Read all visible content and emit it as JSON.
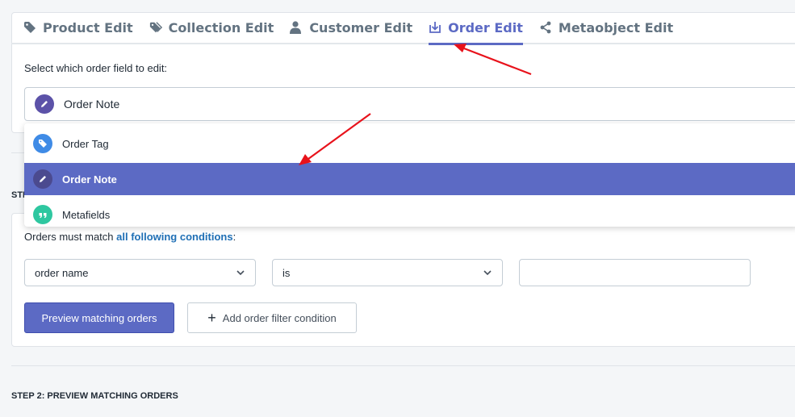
{
  "tabs": [
    {
      "label": "Product Edit",
      "icon": "tag-icon"
    },
    {
      "label": "Collection Edit",
      "icon": "tags-icon"
    },
    {
      "label": "Customer Edit",
      "icon": "user-icon"
    },
    {
      "label": "Order Edit",
      "icon": "download-icon",
      "active": true
    },
    {
      "label": "Metaobject Edit",
      "icon": "share-icon"
    }
  ],
  "field_select": {
    "label": "Select which order field to edit:",
    "value": "Order Note",
    "options": [
      {
        "label": "Order Tag",
        "icon": "tag-icon"
      },
      {
        "label": "Order Note",
        "icon": "pencil-icon",
        "selected": true
      },
      {
        "label": "Metafields",
        "icon": "quote-icon"
      }
    ]
  },
  "step1_partial": "STI",
  "conditions": {
    "prefix": "Orders must match ",
    "link": "all following conditions",
    "suffix": ":",
    "field": "order name",
    "operator": "is",
    "value": ""
  },
  "buttons": {
    "preview": "Preview matching orders",
    "add_filter": "Add order filter condition"
  },
  "step2": "STEP 2: PREVIEW MATCHING ORDERS",
  "colors": {
    "accent": "#5c6ac4",
    "link": "#1f6fb5",
    "arrow": "#e8121b"
  }
}
